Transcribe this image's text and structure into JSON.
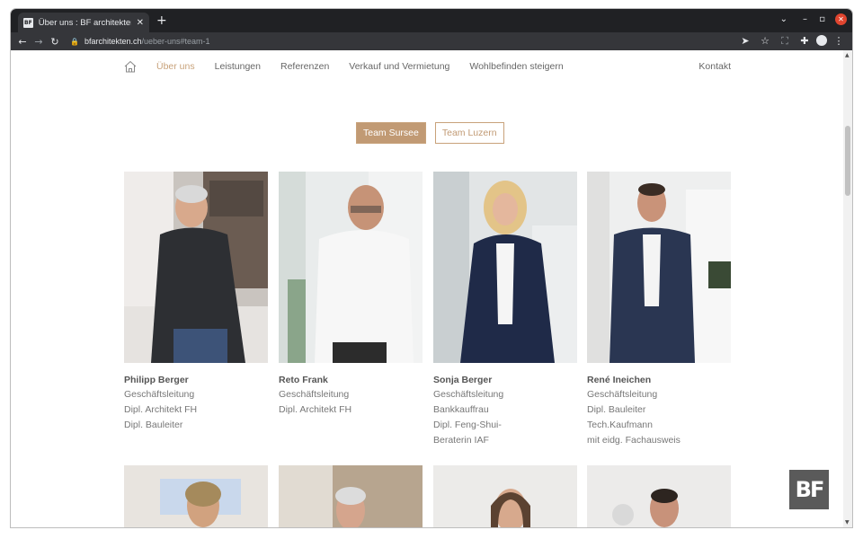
{
  "browser": {
    "tab_title": "Über uns : BF architekten",
    "tab_favicon": "BF",
    "url_domain": "bfarchitekten.ch",
    "url_path": "/ueber-uns#team-1"
  },
  "nav": {
    "items": [
      "Über uns",
      "Leistungen",
      "Referenzen",
      "Verkauf und Vermietung",
      "Wohlbefinden steigern"
    ],
    "contact": "Kontakt"
  },
  "team_tabs": [
    "Team Sursee",
    "Team Luzern"
  ],
  "team": [
    {
      "name": "Philipp Berger",
      "roles": [
        "Geschäftsleitung",
        "Dipl. Architekt FH",
        "Dipl. Bauleiter"
      ]
    },
    {
      "name": "Reto Frank",
      "roles": [
        "Geschäftsleitung",
        "Dipl. Architekt FH"
      ]
    },
    {
      "name": "Sonja Berger",
      "roles": [
        "Geschäftsleitung",
        "Bankkauffrau",
        "Dipl. Feng-Shui-",
        "Beraterin IAF"
      ]
    },
    {
      "name": "René Ineichen",
      "roles": [
        "Geschäftsleitung",
        "Dipl. Bauleiter",
        "Tech.Kaufmann",
        "mit eidg. Fachausweis"
      ]
    }
  ],
  "logo_text": "BF",
  "colors": {
    "accent": "#c19a74",
    "text": "#666666",
    "chrome_dark": "#202124"
  }
}
